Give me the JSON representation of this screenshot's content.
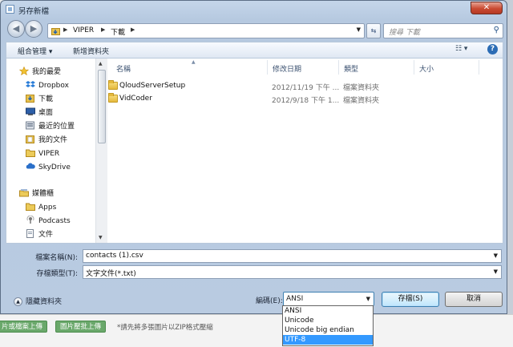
{
  "background": {
    "buttons": [
      "片或檔案上傳",
      "圖片壓批上傳"
    ],
    "hint": "*請先將多張圖片以ZIP格式壓縮"
  },
  "dialog": {
    "title": "另存新檔",
    "close_label": "✕",
    "breadcrumb": [
      "VIPER",
      "下載"
    ],
    "search_placeholder": "搜尋 下載",
    "toolbar": {
      "organize": "組合管理 ▾",
      "new_folder": "新增資料夾",
      "view": "☷ ▾",
      "help": "?"
    },
    "nav_items": [
      {
        "label": "我的最愛",
        "icon": "star-icon"
      },
      {
        "label": "Dropbox",
        "icon": "dropbox-icon"
      },
      {
        "label": "下載",
        "icon": "downloads-icon"
      },
      {
        "label": "桌面",
        "icon": "desktop-icon"
      },
      {
        "label": "最近的位置",
        "icon": "recent-places-icon"
      },
      {
        "label": "我的文件",
        "icon": "documents-icon"
      },
      {
        "label": "VIPER",
        "icon": "folder-icon"
      },
      {
        "label": "SkyDrive",
        "icon": "skydrive-icon"
      },
      {
        "label": "媒體櫃",
        "icon": "libraries-icon"
      },
      {
        "label": "Apps",
        "icon": "folder-icon"
      },
      {
        "label": "Podcasts",
        "icon": "podcast-icon"
      },
      {
        "label": "文件",
        "icon": "documents-icon"
      }
    ],
    "columns": {
      "name": "名稱",
      "date": "修改日期",
      "type": "類型",
      "size": "大小"
    },
    "files": [
      {
        "name": "QloudServerSetup",
        "date": "2012/11/19 下午 ...",
        "type": "檔案資料夾"
      },
      {
        "name": "VidCoder",
        "date": "2012/9/18 下午 1...",
        "type": "檔案資料夾"
      }
    ],
    "filename_label": "檔案名稱(N):",
    "filename_value": "contacts (1).csv",
    "filetype_label": "存檔類型(T):",
    "filetype_value": "文字文件(*.txt)",
    "hide_folders": "隱藏資料夾",
    "encoding_label": "編碼(E):",
    "encoding_value": "ANSI",
    "encoding_options": [
      "ANSI",
      "Unicode",
      "Unicode big endian",
      "UTF-8"
    ],
    "encoding_highlighted": "UTF-8",
    "save_button": "存檔(S)",
    "cancel_button": "取消"
  }
}
